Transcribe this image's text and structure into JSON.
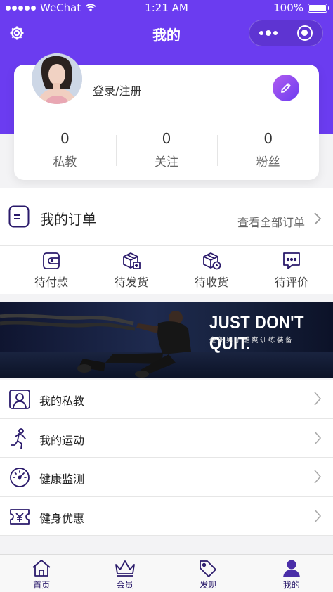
{
  "status_bar": {
    "carrier": "WeChat",
    "time": "1:21 AM",
    "battery": "100%"
  },
  "nav": {
    "title": "我的"
  },
  "profile": {
    "login_text": "登录/注册",
    "stats": [
      {
        "value": "0",
        "label": "私教"
      },
      {
        "value": "0",
        "label": "关注"
      },
      {
        "value": "0",
        "label": "粉丝"
      }
    ]
  },
  "orders": {
    "title": "我的订单",
    "view_all": "查看全部订单",
    "items": [
      {
        "label": "待付款",
        "icon": "wallet-icon"
      },
      {
        "label": "待发货",
        "icon": "package-icon"
      },
      {
        "label": "待收货",
        "icon": "package-clock-icon"
      },
      {
        "label": "待评价",
        "icon": "comment-icon"
      }
    ]
  },
  "banner": {
    "slogan": "JUST DON'T QUIT.",
    "subtitle": "全新男子酷爽训练装备"
  },
  "menu": [
    {
      "label": "我的私教",
      "icon": "trainer-icon"
    },
    {
      "label": "我的运动",
      "icon": "running-icon"
    },
    {
      "label": "健康监测",
      "icon": "gauge-icon"
    },
    {
      "label": "健身优惠",
      "icon": "coupon-icon"
    }
  ],
  "tabbar": [
    {
      "label": "首页",
      "icon": "home-icon"
    },
    {
      "label": "会员",
      "icon": "crown-icon"
    },
    {
      "label": "发现",
      "icon": "tag-icon"
    },
    {
      "label": "我的",
      "icon": "user-icon"
    }
  ],
  "colors": {
    "primary": "#6b3cf0",
    "icon_stroke": "#2a1a6b"
  }
}
